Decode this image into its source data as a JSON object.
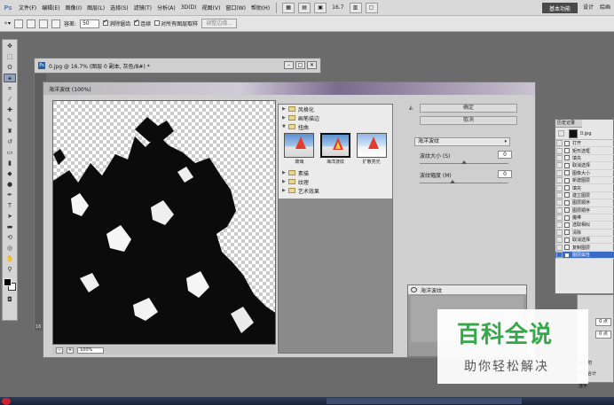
{
  "menubar": {
    "logo": "Ps",
    "items": [
      "文件(F)",
      "编辑(E)",
      "图像(I)",
      "图层(L)",
      "选择(S)",
      "滤镜(T)",
      "分析(A)",
      "3D(D)",
      "视图(V)",
      "窗口(W)",
      "帮助(H)"
    ],
    "zoom": "16.7",
    "workspace_active": "基本功能",
    "workspace_design": "设计",
    "workspace_other": "绘画"
  },
  "options": {
    "tolerance_label": "容差:",
    "tolerance_value": "50",
    "antialias_label": "消除锯齿",
    "contiguous_label": "连续",
    "sample_all_label": "对所有图层取样",
    "refine_label": "调整边缘..."
  },
  "document": {
    "title": "0.jpg @ 16.7% (图层 0 副本, 灰色/8#) *",
    "icon_label": "Ps",
    "zoom_status": "16"
  },
  "filter_gallery": {
    "title": "海洋波纹 (100%)",
    "zoom_value": "100%",
    "categories": [
      {
        "label": "风格化",
        "expanded": false
      },
      {
        "label": "画笔描边",
        "expanded": false
      },
      {
        "label": "扭曲",
        "expanded": true
      },
      {
        "label": "素描",
        "expanded": false
      },
      {
        "label": "纹理",
        "expanded": false
      },
      {
        "label": "艺术效果",
        "expanded": false
      }
    ],
    "thumbnails": [
      {
        "label": "玻璃",
        "selected": false
      },
      {
        "label": "海洋波纹",
        "selected": true
      },
      {
        "label": "扩散亮光",
        "selected": false
      }
    ],
    "ok_label": "确定",
    "cancel_label": "取消",
    "selected_filter": "海洋波纹",
    "params": [
      {
        "label": "波纹大小 (S)",
        "value": "0"
      },
      {
        "label": "波纹幅度 (M)",
        "value": "0"
      }
    ],
    "effect_layer": "海洋波纹"
  },
  "history": {
    "tab_label": "历史记录",
    "snapshot_label": "0.jpg",
    "items": [
      "打开",
      "矩形选框",
      "填充",
      "取消选择",
      "图像大小",
      "新建图层",
      "填充",
      "建立图层",
      "图层顺序",
      "图层顺序",
      "魔棒",
      "选取相似",
      "清除",
      "取消选择",
      "复制图层",
      "图层属性"
    ]
  },
  "side_panel": {
    "values": [
      "0 点",
      "0 点"
    ],
    "label1": "尾部附",
    "label2": "脚组合计",
    "label3": "连字"
  },
  "watermark": {
    "title": "百科全说",
    "subtitle": "助你轻松解决"
  }
}
